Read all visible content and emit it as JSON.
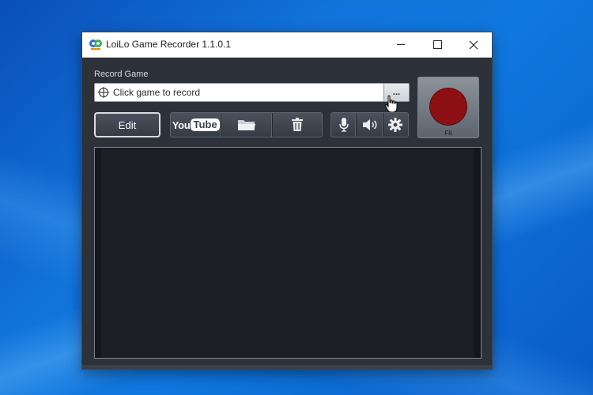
{
  "window": {
    "title": "LoiLo Game Recorder 1.1.0.1"
  },
  "record": {
    "label": "Record Game",
    "game_placeholder": "Click game to record",
    "browse_label": "...",
    "hotkey": "F6"
  },
  "toolbar": {
    "edit_label": "Edit",
    "youtube_you": "You",
    "youtube_tube": "Tube"
  },
  "colors": {
    "record_red": "#8c0f14",
    "panel": "#2c313a",
    "preview": "#1b1e25"
  }
}
